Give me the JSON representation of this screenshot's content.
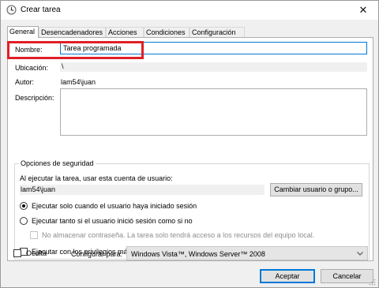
{
  "window": {
    "title": "Crear tarea",
    "close_glyph": "✕"
  },
  "tabs": [
    {
      "label": "General",
      "active": true
    },
    {
      "label": "Desencadenadores",
      "active": false
    },
    {
      "label": "Acciones",
      "active": false
    },
    {
      "label": "Condiciones",
      "active": false
    },
    {
      "label": "Configuración",
      "active": false
    }
  ],
  "general": {
    "name_label": "Nombre:",
    "name_value": "Tarea programada",
    "location_label": "Ubicación:",
    "location_value": "\\",
    "author_label": "Autor:",
    "author_value": "lam54\\juan",
    "description_label": "Descripción:",
    "description_value": ""
  },
  "security": {
    "legend": "Opciones de seguridad",
    "run_as_text": "Al ejecutar la tarea, usar esta cuenta de usuario:",
    "user_value": "lam54\\juan",
    "change_user_button": "Cambiar usuario o grupo...",
    "radio_logged_on": "Ejecutar solo cuando el usuario haya iniciado sesión",
    "radio_whether": "Ejecutar tanto si el usuario inició sesión como si no",
    "no_store_password": "No almacenar contraseña. La tarea solo tendrá acceso a los recursos del equipo local.",
    "highest_privileges": "Ejecutar con los privilegios más altos",
    "selected_option": "radio_logged_on"
  },
  "footer": {
    "hidden_label": "Oculta",
    "configure_label": "Configurar para:",
    "configure_value": "Windows Vista™, Windows Server™ 2008",
    "ok_button": "Aceptar",
    "cancel_button": "Cancelar"
  },
  "colors": {
    "highlight_box": "#e01f26",
    "focus_border": "#0078d7"
  },
  "icons": {
    "title": "task-scheduler-icon",
    "dropdown": "chevron-down-icon",
    "resize": "size-grip-icon"
  }
}
